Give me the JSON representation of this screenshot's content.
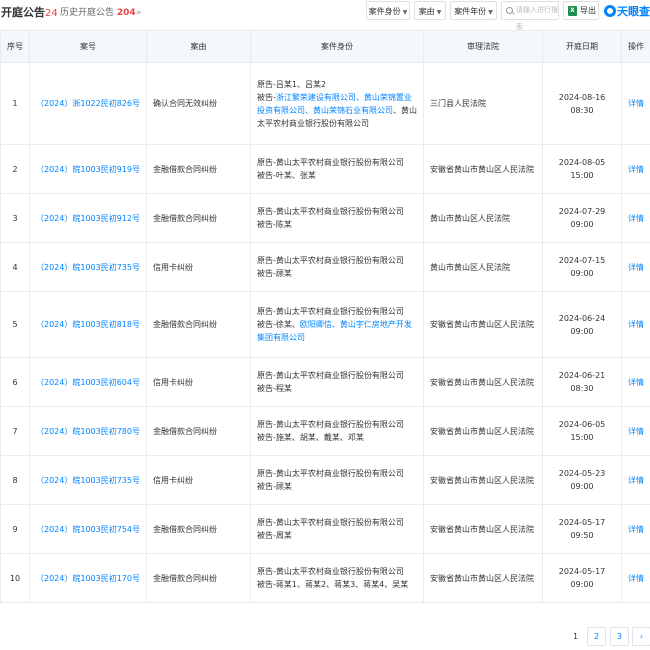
{
  "header": {
    "title": "开庭公告",
    "count": "24",
    "history_label": "历史开庭公告",
    "history_count": "204",
    "history_chevron": "»",
    "filters": [
      {
        "label": "案件身份"
      },
      {
        "label": "案由"
      },
      {
        "label": "案件年份"
      }
    ],
    "search_placeholder": "请输入进行搜索",
    "export_label": "导出",
    "export_icon_text": "X",
    "logo_text": "天眼查"
  },
  "table": {
    "columns": [
      "序号",
      "案号",
      "案由",
      "案件身份",
      "审理法院",
      "开庭日期",
      "操作"
    ],
    "rows": [
      {
        "no": "1",
        "case_no": "（2024）浙1022民初826号",
        "cause": "确认合同无效纠纷",
        "parties_plain_1": "原告-吕某1、吕某2",
        "parties_prefix_2": "被告-",
        "parties_blue_2": "浙江繁荣建设有限公司、黄山荣锦置业投资有限公司、黄山荣锦石业有限公司",
        "parties_plain_2b": "、黄山太平农村商业银行股份有限公司",
        "court": "三门县人民法院",
        "date": "2024-08-16 08:30",
        "action": "详情"
      },
      {
        "no": "2",
        "case_no": "（2024）皖1003民初919号",
        "cause": "金融借款合同纠纷",
        "parties_plain_1": "原告-黄山太平农村商业银行股份有限公司",
        "parties_prefix_2": "被告-叶某、张某",
        "parties_blue_2": "",
        "parties_plain_2b": "",
        "court": "安徽省黄山市黄山区人民法院",
        "date": "2024-08-05 15:00",
        "action": "详情"
      },
      {
        "no": "3",
        "case_no": "（2024）皖1003民初912号",
        "cause": "金融借款合同纠纷",
        "parties_plain_1": "原告-黄山太平农村商业银行股份有限公司",
        "parties_prefix_2": "被告-陈某",
        "parties_blue_2": "",
        "parties_plain_2b": "",
        "court": "黄山市黄山区人民法院",
        "date": "2024-07-29 09:00",
        "action": "详情"
      },
      {
        "no": "4",
        "case_no": "（2024）皖1003民初735号",
        "cause": "信用卡纠纷",
        "parties_plain_1": "原告-黄山太平农村商业银行股份有限公司",
        "parties_prefix_2": "被告-顾某",
        "parties_blue_2": "",
        "parties_plain_2b": "",
        "court": "黄山市黄山区人民法院",
        "date": "2024-07-15 09:00",
        "action": "详情"
      },
      {
        "no": "5",
        "case_no": "（2024）皖1003民初818号",
        "cause": "金融借款合同纠纷",
        "parties_plain_1": "原告-黄山太平农村商业银行股份有限公司",
        "parties_prefix_2": "被告-徐某、",
        "parties_blue_2": "欧阳卿信、黄山宇仁房地产开发集团有限公司",
        "parties_plain_2b": "",
        "court": "安徽省黄山市黄山区人民法院",
        "date": "2024-06-24 09:00",
        "action": "详情"
      },
      {
        "no": "6",
        "case_no": "（2024）皖1003民初604号",
        "cause": "信用卡纠纷",
        "parties_plain_1": "原告-黄山太平农村商业银行股份有限公司",
        "parties_prefix_2": "被告-程某",
        "parties_blue_2": "",
        "parties_plain_2b": "",
        "court": "安徽省黄山市黄山区人民法院",
        "date": "2024-06-21 08:30",
        "action": "详情"
      },
      {
        "no": "7",
        "case_no": "（2024）皖1003民初780号",
        "cause": "金融借款合同纠纷",
        "parties_plain_1": "原告-黄山太平农村商业银行股份有限公司",
        "parties_prefix_2": "被告-施某、胡某、戴某、邓某",
        "parties_blue_2": "",
        "parties_plain_2b": "",
        "court": "安徽省黄山市黄山区人民法院",
        "date": "2024-06-05 15:00",
        "action": "详情"
      },
      {
        "no": "8",
        "case_no": "（2024）皖1003民初735号",
        "cause": "信用卡纠纷",
        "parties_plain_1": "原告-黄山太平农村商业银行股份有限公司",
        "parties_prefix_2": "被告-顾某",
        "parties_blue_2": "",
        "parties_plain_2b": "",
        "court": "安徽省黄山市黄山区人民法院",
        "date": "2024-05-23 09:00",
        "action": "详情"
      },
      {
        "no": "9",
        "case_no": "（2024）皖1003民初754号",
        "cause": "金融借款合同纠纷",
        "parties_plain_1": "原告-黄山太平农村商业银行股份有限公司",
        "parties_prefix_2": "被告-周某",
        "parties_blue_2": "",
        "parties_plain_2b": "",
        "court": "安徽省黄山市黄山区人民法院",
        "date": "2024-05-17 09:50",
        "action": "详情"
      },
      {
        "no": "10",
        "case_no": "（2024）皖1003民初170号",
        "cause": "金融借款合同纠纷",
        "parties_plain_1": "原告-黄山太平农村商业银行股份有限公司",
        "parties_prefix_2": "被告-蒋某1、蒋某2、蒋某3、蒋某4、吴某",
        "parties_blue_2": "",
        "parties_plain_2b": "",
        "court": "安徽省黄山市黄山区人民法院",
        "date": "2024-05-17 09:00",
        "action": "详情"
      }
    ]
  },
  "pagination": {
    "pages": [
      "1",
      "2",
      "3"
    ],
    "current": "1",
    "next": "›"
  },
  "colors": {
    "accent": "#0084ff",
    "count_red": "#f04142",
    "header_bg": "#f4f7fc"
  }
}
